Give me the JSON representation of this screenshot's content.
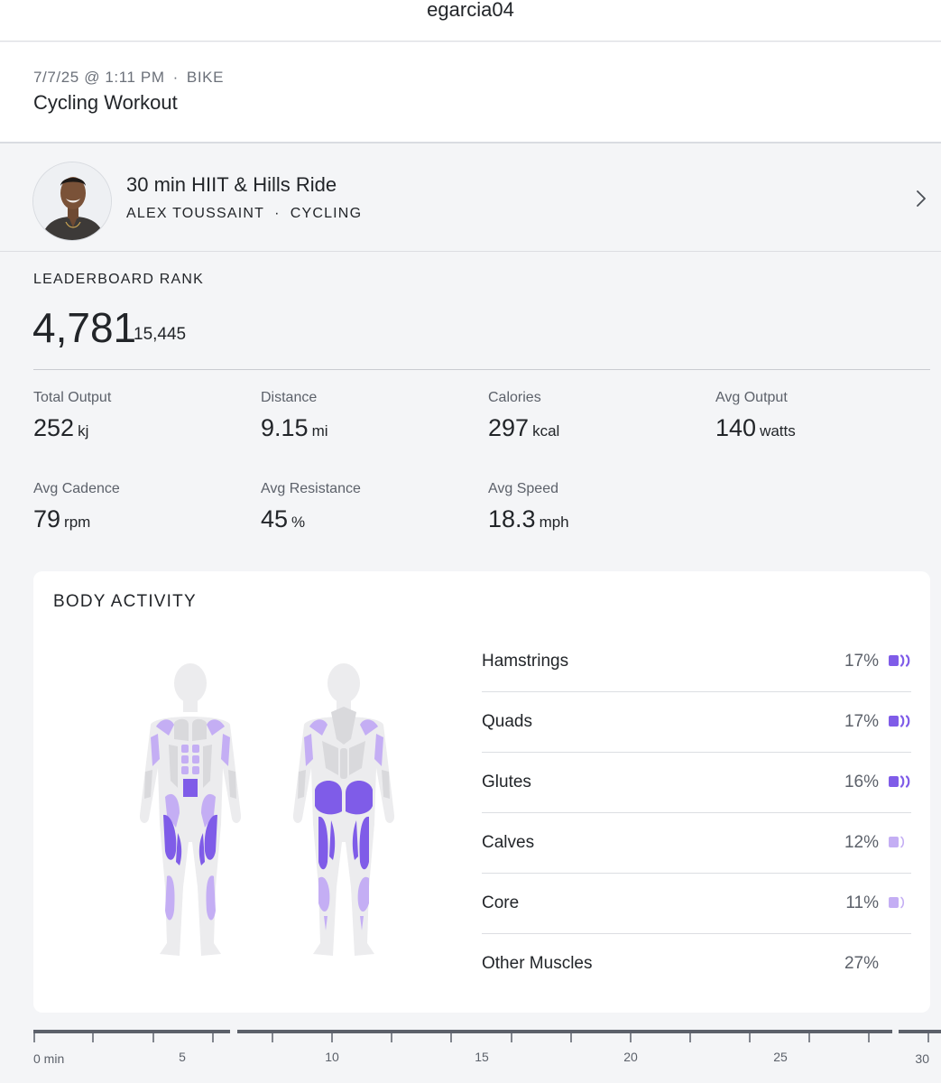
{
  "header": {
    "username": "egarcia04"
  },
  "workout": {
    "date": "7/7/25 @ 1:11 PM",
    "sep": "·",
    "discipline": "BIKE",
    "title": "Cycling Workout"
  },
  "class_info": {
    "title": "30 min HIIT & Hills Ride",
    "instructor": "ALEX TOUSSAINT",
    "sep": "·",
    "category": "CYCLING"
  },
  "leaderboard": {
    "label": "LEADERBOARD RANK",
    "rank": "4,781",
    "total": "15,445"
  },
  "metrics": [
    {
      "label": "Total Output",
      "value": "252",
      "unit": "kj"
    },
    {
      "label": "Distance",
      "value": "9.15",
      "unit": "mi"
    },
    {
      "label": "Calories",
      "value": "297",
      "unit": "kcal"
    },
    {
      "label": "Avg Output",
      "value": "140",
      "unit": "watts"
    },
    {
      "label": "Avg Cadence",
      "value": "79",
      "unit": "rpm"
    },
    {
      "label": "Avg Resistance",
      "value": "45",
      "unit": "%"
    },
    {
      "label": "Avg Speed",
      "value": "18.3",
      "unit": "mph"
    }
  ],
  "body_activity": {
    "title": "BODY ACTIVITY",
    "muscles": [
      {
        "name": "Hamstrings",
        "percent": "17%",
        "level": 3
      },
      {
        "name": "Quads",
        "percent": "17%",
        "level": 3
      },
      {
        "name": "Glutes",
        "percent": "16%",
        "level": 3
      },
      {
        "name": "Calves",
        "percent": "12%",
        "level": 1
      },
      {
        "name": "Core",
        "percent": "11%",
        "level": 1
      },
      {
        "name": "Other Muscles",
        "percent": "27%",
        "level": 0
      }
    ]
  },
  "timeline": {
    "labels": [
      "0 min",
      "5",
      "10",
      "15",
      "20",
      "25",
      "30"
    ]
  },
  "colors": {
    "accent_strong": "#7f5ce8",
    "accent_light": "#c4aef4",
    "muscle_inactive": "#d9d9dc",
    "body_base": "#ececee"
  }
}
